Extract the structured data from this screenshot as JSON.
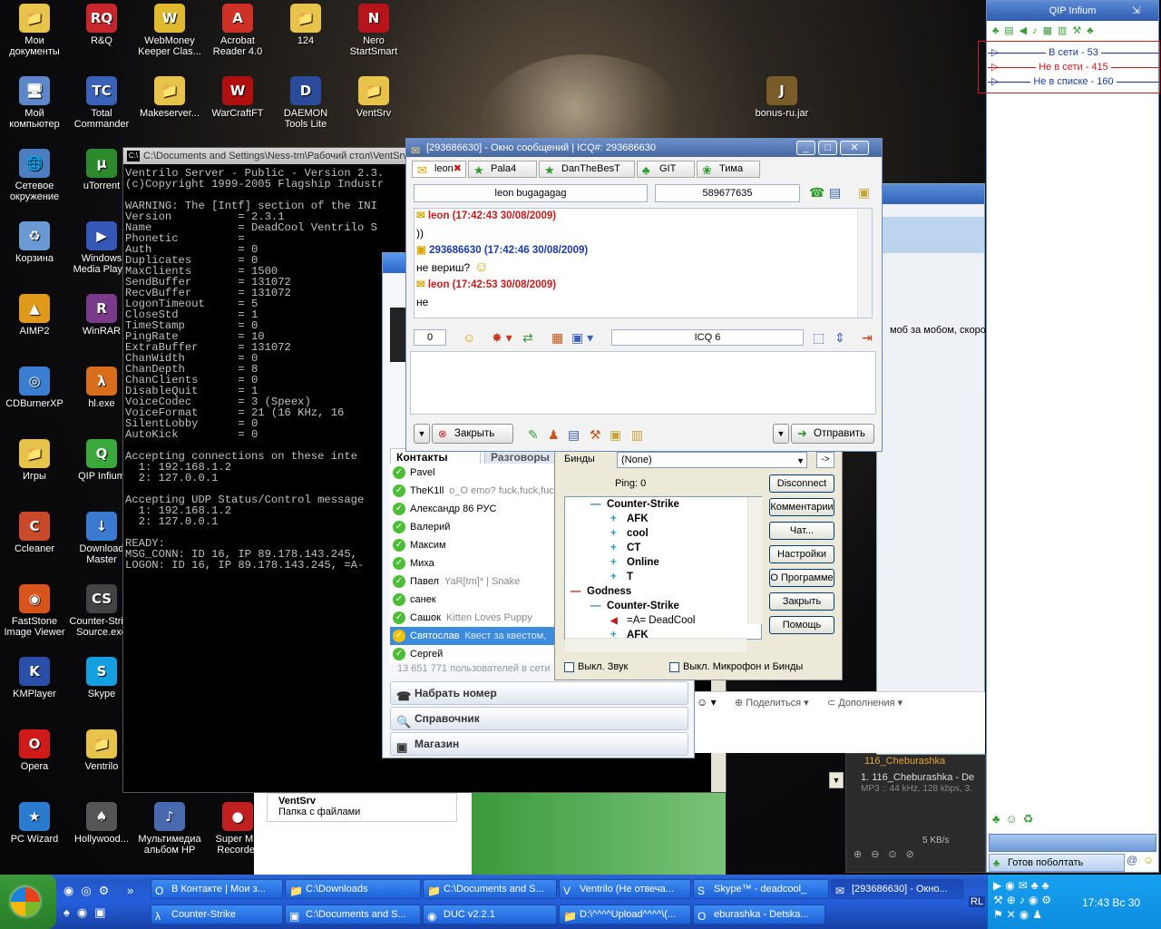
{
  "desktop": {
    "icons": [
      {
        "label": "Мои документы",
        "glyph": "📁",
        "color": "#e8c34b"
      },
      {
        "label": "R&Q",
        "glyph": "RQ",
        "color": "#c8262a"
      },
      {
        "label": "WebMoney Keeper Clas...",
        "glyph": "W",
        "color": "#e0b92f"
      },
      {
        "label": "Acrobat Reader 4.0",
        "glyph": "A",
        "color": "#d03127"
      },
      {
        "label": "124",
        "glyph": "📁",
        "color": "#e8c34b"
      },
      {
        "label": "Nero StartSmart",
        "glyph": "N",
        "color": "#b8141d"
      },
      {
        "label": "Мой компьютер",
        "glyph": "🖥",
        "color": "#5d87c8"
      },
      {
        "label": "Total Commander",
        "glyph": "TC",
        "color": "#3a62b8"
      },
      {
        "label": "Makeserver...",
        "glyph": "📁",
        "color": "#e8c34b"
      },
      {
        "label": "WarCraftFT",
        "glyph": "W",
        "color": "#b01010"
      },
      {
        "label": "DAEMON Tools Lite",
        "glyph": "D",
        "color": "#2a4a9a"
      },
      {
        "label": "VentSrv",
        "glyph": "📁",
        "color": "#e8c34b"
      },
      {
        "label": "bonus-ru.jar",
        "glyph": "J",
        "color": "#7a5c2a"
      },
      {
        "label": "Сетевое окружение",
        "glyph": "🌐",
        "color": "#4c7fc2"
      },
      {
        "label": "uTorrent",
        "glyph": "μ",
        "color": "#2c8a2c"
      },
      {
        "label": "Корзина",
        "glyph": "♻",
        "color": "#6a9ad4"
      },
      {
        "label": "Windows Media Play...",
        "glyph": "▶",
        "color": "#3457b8"
      },
      {
        "label": "AIMP2",
        "glyph": "▲",
        "color": "#e09a1a"
      },
      {
        "label": "WinRAR",
        "glyph": "R",
        "color": "#7a3a8a"
      },
      {
        "label": "CDBurnerXP",
        "glyph": "◎",
        "color": "#3b7ed1"
      },
      {
        "label": "hl.exe",
        "glyph": "λ",
        "color": "#d86e1c"
      },
      {
        "label": "Игры",
        "glyph": "📁",
        "color": "#e8c34b"
      },
      {
        "label": "QIP Infium",
        "glyph": "Q",
        "color": "#3aa83a"
      },
      {
        "label": "Ccleaner",
        "glyph": "C",
        "color": "#c84a2a"
      },
      {
        "label": "Download Master",
        "glyph": "↓",
        "color": "#3a7ad0"
      },
      {
        "label": "FastStone Image Viewer",
        "glyph": "◉",
        "color": "#d8541c"
      },
      {
        "label": "Counter-Strike Source.exe",
        "glyph": "CS",
        "color": "#444"
      },
      {
        "label": "KMPlayer",
        "glyph": "K",
        "color": "#2a4fa8"
      },
      {
        "label": "Skype",
        "glyph": "S",
        "color": "#14a0e0"
      },
      {
        "label": "Opera",
        "glyph": "O",
        "color": "#d01a1a"
      },
      {
        "label": "Ventrilo",
        "glyph": "📁",
        "color": "#e8c34b"
      },
      {
        "label": "PC Wizard",
        "glyph": "★",
        "color": "#2a7ad0"
      },
      {
        "label": "Hollywood...",
        "glyph": "♠",
        "color": "#555"
      },
      {
        "label": "Мультимедиа альбом HP",
        "glyph": "♪",
        "color": "#4a6ab0"
      },
      {
        "label": "Super MP Recorder",
        "glyph": "●",
        "color": "#c02020"
      }
    ]
  },
  "console": {
    "title": "C:\\Documents and Settings\\Ness-tm\\Рабочий стол\\VentSrv",
    "lines": [
      "Ventrilo Server - Public - Version 2.3.",
      "(c)Copyright 1999-2005 Flagship Industr",
      "",
      "WARNING: The [Intf] section of the INI ",
      "Version          = 2.3.1",
      "Name             = DeadCool Ventrilo S",
      "Phonetic         =",
      "Auth             = 0",
      "Duplicates       = 0",
      "MaxClients       = 1500",
      "SendBuffer       = 131072",
      "RecvBuffer       = 131072",
      "LogonTimeout     = 5",
      "CloseStd         = 1",
      "TimeStamp        = 0",
      "PingRate         = 10",
      "ExtraBuffer      = 131072",
      "ChanWidth        = 0",
      "ChanDepth        = 8",
      "ChanClients      = 0",
      "DisableQuit      = 1",
      "VoiceCodec       = 3 (Speex)",
      "VoiceFormat      = 21 (16 KHz, 16 ",
      "SilentLobby      = 0",
      "AutoKick         = 0",
      "",
      "Accepting connections on these inte",
      "  1: 192.168.1.2",
      "  2: 127.0.0.1",
      "",
      "Accepting UDP Status/Control message",
      "  1: 192.168.1.2",
      "  2: 127.0.0.1",
      "",
      "READY:",
      "MSG_CONN: ID 16, IP 89.178.143.245,",
      "LOGON: ID 16, IP 89.178.143.245, =A-"
    ]
  },
  "skype": {
    "tabs": [
      "Контакты",
      "Разговоры"
    ],
    "contacts": [
      {
        "name": "Pavel",
        "mood": ""
      },
      {
        "name": "TheK1ll",
        "mood": "o_O emo? fuck,fuck,fuck"
      },
      {
        "name": "Александр 86 РУС",
        "mood": ""
      },
      {
        "name": "Валерий",
        "mood": ""
      },
      {
        "name": "Максим",
        "mood": ""
      },
      {
        "name": "Миха",
        "mood": ""
      },
      {
        "name": "Павел",
        "mood": "YaR[tm]* | Snake"
      },
      {
        "name": "санек",
        "mood": ""
      },
      {
        "name": "Сашок",
        "mood": "Kitten Loves Puppy"
      },
      {
        "name": "Святослав",
        "mood": "Квест за квестом,"
      },
      {
        "name": "Сергей",
        "mood": ""
      }
    ],
    "users_online": "13 651 771 пользователей в сети",
    "buttons": [
      "Набрать номер",
      "Справочник",
      "Магазин"
    ],
    "bg_window_text": "моб за мобом, скоро",
    "share_label": "Поделиться",
    "more_label": "Дополнения"
  },
  "ventrilo": {
    "binds_label": "Бинды",
    "binds_value": "(None)",
    "ping": "Ping: 0",
    "tree": [
      {
        "level": 1,
        "sign": "minus",
        "label": "Counter-Strike",
        "bold": true
      },
      {
        "level": 2,
        "sign": "plus",
        "label": "AFK",
        "bold": true
      },
      {
        "level": 2,
        "sign": "plus",
        "label": "cool",
        "bold": true
      },
      {
        "level": 2,
        "sign": "plus",
        "label": "CT",
        "bold": true
      },
      {
        "level": 2,
        "sign": "plus",
        "label": "Online",
        "bold": true
      },
      {
        "level": 2,
        "sign": "plus",
        "label": "T",
        "bold": true
      },
      {
        "level": 0,
        "sign": "red",
        "label": "Godness",
        "bold": true
      },
      {
        "level": 1,
        "sign": "minus",
        "label": "Counter-Strike",
        "bold": true
      },
      {
        "level": 2,
        "sign": "speaker",
        "label": "=A= DeadCool",
        "bold": false
      },
      {
        "level": 2,
        "sign": "plus",
        "label": "AFK",
        "bold": true
      }
    ],
    "buttons": [
      "Disconnect",
      "Комментарии",
      "Чат...",
      "Настройки",
      "О Программе",
      "Закрыть",
      "Помощь"
    ],
    "chk_sound": "Выкл. Звук",
    "chk_mic": "Выкл. Микрофон и Бинды"
  },
  "icq": {
    "title": "[293686630] - Окно сообщений | ICQ#: 293686630",
    "tabs": [
      "leon",
      "Pala4",
      "DanTheBesT",
      "GIT",
      "Тима"
    ],
    "contact_name": "leon bugagagag",
    "contact_uin": "589677635",
    "messages": [
      {
        "head": "leon (17:42:43 30/08/2009)",
        "text": "))",
        "mine": false
      },
      {
        "head": "293686630 (17:42:46 30/08/2009)",
        "text": "не вериш?",
        "mine": true
      },
      {
        "head": "leon (17:42:53 30/08/2009)",
        "text": "не",
        "mine": false
      }
    ],
    "char_count": "0",
    "client_label": "ICQ 6",
    "close_btn": "Закрыть",
    "send_btn": "Отправить"
  },
  "qip": {
    "title": "QIP Infium",
    "groups": [
      {
        "label": "В сети - 53",
        "color": "#1a3a9a"
      },
      {
        "label": "Не в сети - 415",
        "color": "#c81a1a"
      },
      {
        "label": "Не в списке - 160",
        "color": "#1a3a9a"
      }
    ],
    "status": "Готов поболтать"
  },
  "media": {
    "playlist_head": "116_Cheburashka",
    "track": "1. 116_Cheburashka - De",
    "info": "MP3 :: 44 kHz, 128 kbps, 3.",
    "rate": "5 KB/s",
    "folder_name": "VentSrv",
    "folder_type": "Папка с файлами"
  },
  "taskbar": {
    "row1": [
      {
        "label": "В Контакте | Мои з...",
        "glyph": "O",
        "active": false
      },
      {
        "label": "C:\\Downloads",
        "glyph": "📁",
        "active": false
      },
      {
        "label": "C:\\Documents and S...",
        "glyph": "📁",
        "active": false
      },
      {
        "label": "Ventrilo (Не отвеча...",
        "glyph": "V",
        "active": false
      },
      {
        "label": "Skype™ - deadcool_",
        "glyph": "S",
        "active": false
      },
      {
        "label": "[293686630] - Окно...",
        "glyph": "✉",
        "active": true
      }
    ],
    "row2": [
      {
        "label": "Counter-Strike",
        "glyph": "λ",
        "active": false
      },
      {
        "label": "C:\\Documents and S...",
        "glyph": "▣",
        "active": false
      },
      {
        "label": "DUC v2.2.1",
        "glyph": "◉",
        "active": false
      },
      {
        "label": "D:\\^^^^Upload^^^^\\(...",
        "glyph": "📁",
        "active": false
      },
      {
        "label": "eburashka - Detska...",
        "glyph": "O",
        "active": false
      }
    ],
    "lang": "RL",
    "clock": "17:43 Вс 30"
  }
}
